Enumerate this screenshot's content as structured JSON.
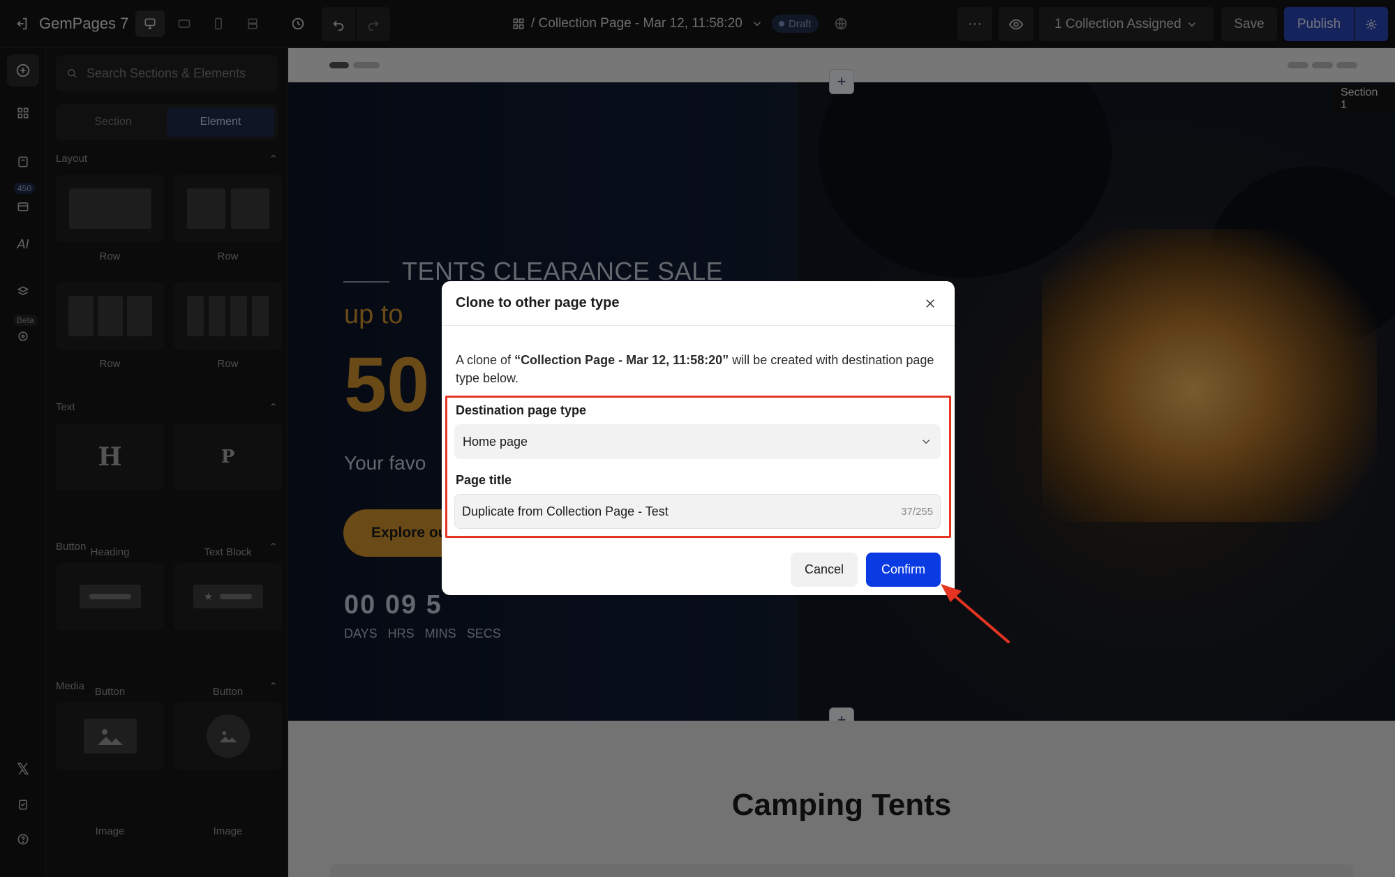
{
  "app": {
    "name": "GemPages 7"
  },
  "header": {
    "page_title": "/ Collection Page - Mar 12, 11:58:20",
    "status_badge": "Draft",
    "more": "···",
    "assigned": "1 Collection Assigned",
    "save": "Save",
    "publish": "Publish"
  },
  "rail": {
    "badge": "450",
    "beta": "Beta"
  },
  "panel": {
    "search_placeholder": "Search Sections & Elements",
    "tabs": [
      "Section",
      "Element"
    ],
    "layout": {
      "title": "Layout",
      "items": [
        "Row",
        "Row",
        "Row",
        "Row"
      ]
    },
    "text": {
      "title": "Text",
      "items": [
        "Heading",
        "Text Block"
      ],
      "glyphs": [
        "H",
        "P"
      ]
    },
    "button": {
      "title": "Button",
      "items": [
        "Button",
        "Button"
      ]
    },
    "media": {
      "title": "Media",
      "items": [
        "Image",
        "Image"
      ]
    }
  },
  "canvas": {
    "section_chip": "Section 1",
    "hero_sub": "TENTS CLEARANCE SALE",
    "hero_upto": "up to",
    "hero_big": "50",
    "hero_fav": "Your favo",
    "hero_btn": "Explore ou",
    "countdown": "00 09 5",
    "countdown_labels": "DAYS HRS MINS SECS",
    "lower_title": "Camping Tents"
  },
  "modal": {
    "title": "Clone to other page type",
    "desc_prefix": "A clone of ",
    "desc_name": "“Collection Page - Mar 12, 11:58:20”",
    "desc_suffix": " will be created with destination page type below.",
    "dest_label": "Destination page type",
    "dest_value": "Home page",
    "title_label": "Page title",
    "title_value": "Duplicate from Collection Page - Test",
    "counter": "37/255",
    "cancel": "Cancel",
    "confirm": "Confirm"
  },
  "colors": {
    "accent": "#0a3be2",
    "highlight": "#e63422",
    "hero_gold": "#d4962e"
  }
}
